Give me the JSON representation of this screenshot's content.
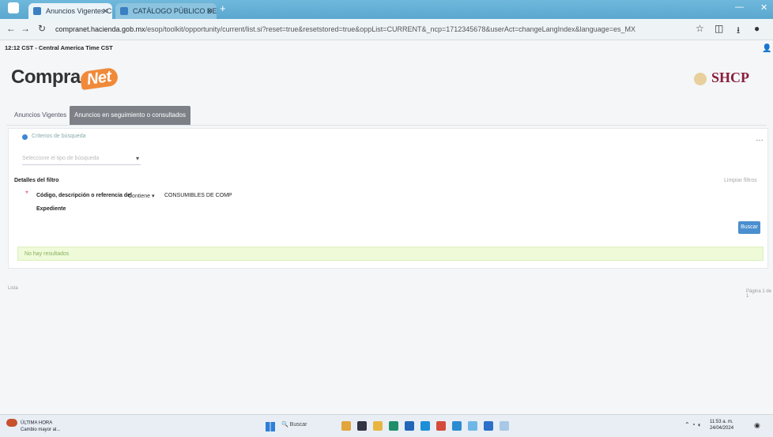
{
  "browser": {
    "tabs": [
      {
        "label": "Anuncios Vigentes CompraNet"
      },
      {
        "label": "CATÁLOGO PÚBLICO DE COM"
      }
    ],
    "new_tab": "+",
    "url_host": "compranet.hacienda.gob.mx",
    "url_path": "/esop/toolkit/opportunity/current/list.si?reset=true&resetstored=true&oppList=CURRENT&_ncp=1712345678&userAct=changeLangIndex&language=es_MX",
    "toolbar_icons": [
      "star-icon",
      "extensions-icon",
      "download-icon",
      "profile-icon"
    ]
  },
  "page": {
    "timezone": "12:12 CST - Central America Time CST",
    "logo_compra": "Compra",
    "logo_net": "Net",
    "shcp": "SHCP",
    "tabs": [
      {
        "label": "Anuncios Vigentes"
      },
      {
        "label": "Anuncios en seguimiento o consultados"
      }
    ],
    "radio_label": "Criterios de búsqueda",
    "select_placeholder": "Seleccione el tipo de búsqueda",
    "filter_title": "Detalles del filtro",
    "clear_link": "Limpiar filtros",
    "code_label_line1": "Código, descripción o referencia del",
    "code_label_line2": "Expediente",
    "operator": "Contiene",
    "code_value": "CONSUMIBLES DE COMP",
    "search_button": "Buscar",
    "alert": "No hay resultados",
    "section_label": "Lista",
    "pagination": "Página 1 de 1"
  },
  "taskbar": {
    "weather_line1": "ÚLTIMA HORA",
    "weather_line2": "Cambio mayor al...",
    "search": "Buscar",
    "time": "11:53 a. m.",
    "date": "24/04/2024"
  }
}
